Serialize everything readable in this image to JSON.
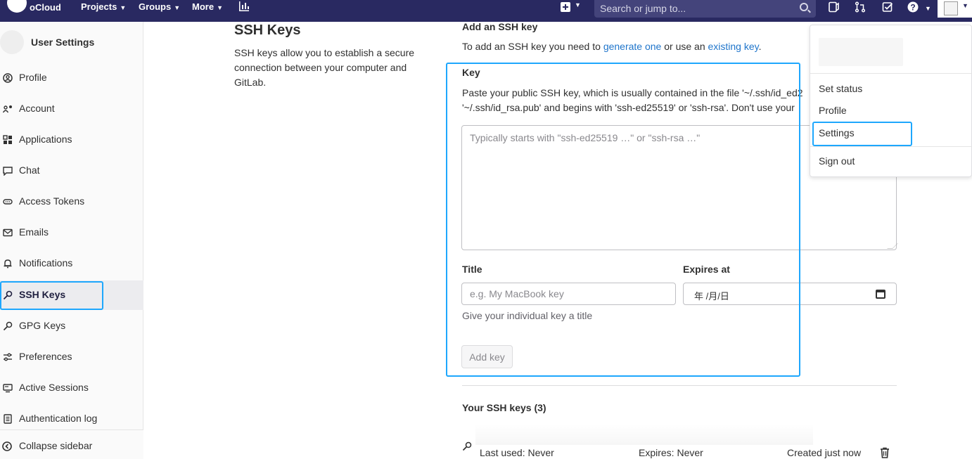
{
  "navbar": {
    "brand": "oCloud",
    "menus": [
      {
        "label": "Projects"
      },
      {
        "label": "Groups"
      },
      {
        "label": "More"
      }
    ],
    "search_placeholder": "Search or jump to...",
    "background": "#292961"
  },
  "sidebar": {
    "title": "User Settings",
    "items": [
      {
        "label": "Profile",
        "icon": "profile-icon"
      },
      {
        "label": "Account",
        "icon": "account-icon"
      },
      {
        "label": "Applications",
        "icon": "applications-icon"
      },
      {
        "label": "Chat",
        "icon": "chat-icon"
      },
      {
        "label": "Access Tokens",
        "icon": "token-icon"
      },
      {
        "label": "Emails",
        "icon": "mail-icon"
      },
      {
        "label": "Notifications",
        "icon": "bell-icon"
      },
      {
        "label": "SSH Keys",
        "icon": "key-icon",
        "active": true
      },
      {
        "label": "GPG Keys",
        "icon": "key-icon"
      },
      {
        "label": "Preferences",
        "icon": "preferences-icon"
      },
      {
        "label": "Active Sessions",
        "icon": "monitor-icon"
      },
      {
        "label": "Authentication log",
        "icon": "log-icon"
      }
    ],
    "collapse_label": "Collapse sidebar"
  },
  "main": {
    "title": "SSH Keys",
    "description": "SSH keys allow you to establish a secure connection between your computer and GitLab.",
    "add_heading": "Add an SSH key",
    "add_desc_prefix": "To add an SSH key you need to ",
    "generate_link": "generate one",
    "add_desc_middle": " or use an ",
    "existing_link": "existing key",
    "add_desc_suffix": ".",
    "key_label": "Key",
    "key_help_line1": "Paste your public SSH key, which is usually contained in the file '~/.ssh/id_ed2",
    "key_help_line2": "'~/.ssh/id_rsa.pub' and begins with 'ssh-ed25519' or 'ssh-rsa'. Don't use your",
    "key_placeholder": "Typically starts with \"ssh-ed25519 …\" or \"ssh-rsa …\"",
    "title_label": "Title",
    "title_placeholder": "e.g. My MacBook key",
    "title_help": "Give your individual key a title",
    "expires_label": "Expires at",
    "expires_value": "年 /月/日",
    "add_button": "Add key",
    "your_keys_heading": "Your SSH keys (3)",
    "key_row": {
      "last_used": "Last used: Never",
      "expires": "Expires: Never",
      "created": "Created just now"
    }
  },
  "dropdown": {
    "items": [
      "Set status",
      "Profile",
      "Settings",
      "Sign out"
    ]
  },
  "colors": {
    "highlight": "#1ea7fd",
    "link": "#1f75cb"
  }
}
